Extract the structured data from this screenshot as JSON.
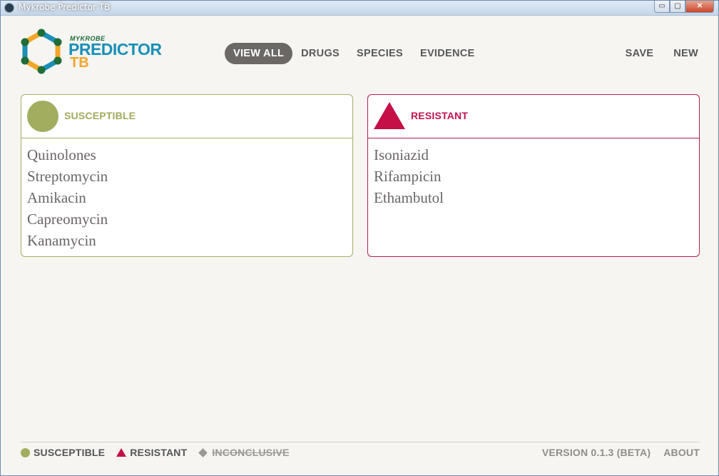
{
  "window": {
    "title": "Mykrobe Predictor TB",
    "minimize": "▭",
    "maximize": "▢",
    "close": "✕"
  },
  "brand": {
    "top": "MYKROBE",
    "main": "PREDICTOR",
    "sub": "TB"
  },
  "nav": {
    "left": [
      "VIEW ALL",
      "DRUGS",
      "SPECIES",
      "EVIDENCE"
    ],
    "right": [
      "SAVE",
      "NEW"
    ],
    "active": "VIEW ALL"
  },
  "panels": {
    "susceptible": {
      "title": "SUSCEPTIBLE",
      "color": "#a2ad60",
      "drugs": [
        "Quinolones",
        "Streptomycin",
        "Amikacin",
        "Capreomycin",
        "Kanamycin"
      ]
    },
    "resistant": {
      "title": "RESISTANT",
      "color": "#c50f47",
      "drugs": [
        "Isoniazid",
        "Rifampicin",
        "Ethambutol"
      ]
    }
  },
  "legend": {
    "susceptible": "SUSCEPTIBLE",
    "resistant": "RESISTANT",
    "inconclusive": "INCONCLUSIVE"
  },
  "footer": {
    "version": "VERSION 0.1.3 (BETA)",
    "about": "ABOUT"
  },
  "icons": {
    "app": "mykrobe-app-icon",
    "logo": "hexagon-logo-icon",
    "susceptible": "circle-icon",
    "resistant": "triangle-icon",
    "inconclusive": "diamond-icon"
  }
}
